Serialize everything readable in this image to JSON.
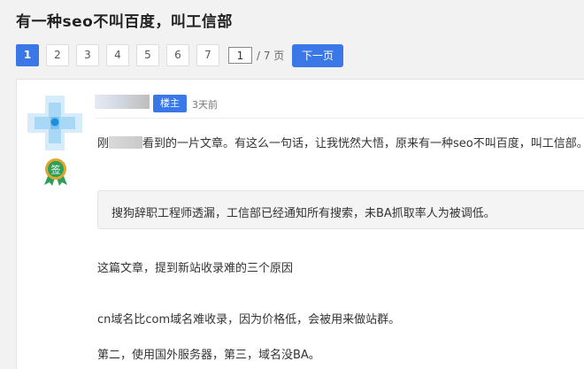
{
  "thread": {
    "title": "有一种seo不叫百度，叫工信部"
  },
  "pagination": {
    "pages": [
      "1",
      "2",
      "3",
      "4",
      "5",
      "6",
      "7"
    ],
    "current_page": "1",
    "total_label": "/ 7 页",
    "next_label": "下一页"
  },
  "post": {
    "author_badge": "楼主",
    "time": "3天前",
    "p1_start": "刚",
    "p1_end": "看到的一片文章。有这么一句话，让我恍然大悟，原来有一种seo不叫百度，叫工信部。",
    "quote": "搜狗辞职工程师透漏，工信部已经通知所有搜索，未BA抓取率人为被调低。",
    "p2": "这篇文章，提到新站收录难的三个原因",
    "p3": "cn域名比com域名难收录，因为价格低，会被用来做站群。",
    "p4": "第二，使用国外服务器，第三，域名没BA。"
  },
  "colors": {
    "accent": "#3b78e7",
    "medal_green": "#2e9e5b",
    "medal_gold": "#e0a72e"
  }
}
